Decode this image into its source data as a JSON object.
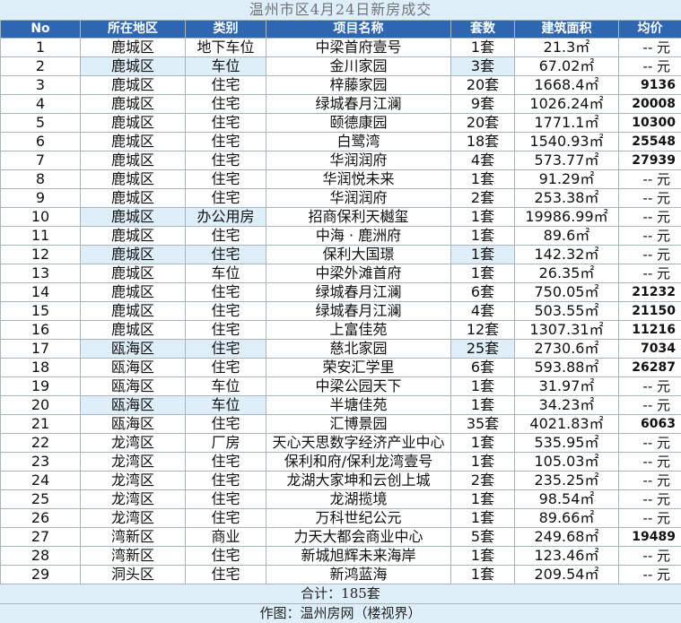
{
  "title": "温州市区4月24日新房成交",
  "columns": [
    "No",
    "所在地区",
    "类别",
    "项目名称",
    "套数",
    "建筑面积",
    "均价"
  ],
  "rows": [
    {
      "no": "1",
      "district": "鹿城区",
      "type": "地下车位",
      "project": "中梁首府壹号",
      "units": "1套",
      "area": "21.3㎡",
      "price": "-- 元"
    },
    {
      "no": "2",
      "district": "鹿城区",
      "type": "车位",
      "project": "金川家园",
      "units": "3套",
      "area": "67.02㎡",
      "price": "-- 元"
    },
    {
      "no": "3",
      "district": "鹿城区",
      "type": "住宅",
      "project": "梓藤家园",
      "units": "20套",
      "area": "1668.4㎡",
      "price": "9136"
    },
    {
      "no": "4",
      "district": "鹿城区",
      "type": "住宅",
      "project": "绿城春月江澜",
      "units": "9套",
      "area": "1026.24㎡",
      "price": "20008"
    },
    {
      "no": "5",
      "district": "鹿城区",
      "type": "住宅",
      "project": "颐德康园",
      "units": "20套",
      "area": "1771.1㎡",
      "price": "10300"
    },
    {
      "no": "6",
      "district": "鹿城区",
      "type": "住宅",
      "project": "白鹭湾",
      "units": "18套",
      "area": "1540.93㎡",
      "price": "25548"
    },
    {
      "no": "7",
      "district": "鹿城区",
      "type": "住宅",
      "project": "华润润府",
      "units": "4套",
      "area": "573.77㎡",
      "price": "27939"
    },
    {
      "no": "8",
      "district": "鹿城区",
      "type": "住宅",
      "project": "华润悦未来",
      "units": "1套",
      "area": "91.29㎡",
      "price": "-- 元"
    },
    {
      "no": "9",
      "district": "鹿城区",
      "type": "住宅",
      "project": "华润润府",
      "units": "2套",
      "area": "253.38㎡",
      "price": "-- 元"
    },
    {
      "no": "10",
      "district": "鹿城区",
      "type": "办公用房",
      "project": "招商保利天樾玺",
      "units": "1套",
      "area": "19986.99㎡",
      "price": "-- 元"
    },
    {
      "no": "11",
      "district": "鹿城区",
      "type": "住宅",
      "project": "中海 · 鹿洲府",
      "units": "1套",
      "area": "89.6㎡",
      "price": "-- 元"
    },
    {
      "no": "12",
      "district": "鹿城区",
      "type": "住宅",
      "project": "保利大国璟",
      "units": "1套",
      "area": "142.32㎡",
      "price": "-- 元"
    },
    {
      "no": "13",
      "district": "鹿城区",
      "type": "车位",
      "project": "中梁外滩首府",
      "units": "1套",
      "area": "26.35㎡",
      "price": "-- 元"
    },
    {
      "no": "14",
      "district": "鹿城区",
      "type": "住宅",
      "project": "绿城春月江澜",
      "units": "6套",
      "area": "750.05㎡",
      "price": "21232"
    },
    {
      "no": "15",
      "district": "鹿城区",
      "type": "住宅",
      "project": "绿城春月江澜",
      "units": "4套",
      "area": "503.55㎡",
      "price": "21150"
    },
    {
      "no": "16",
      "district": "鹿城区",
      "type": "住宅",
      "project": "上富佳苑",
      "units": "12套",
      "area": "1307.31㎡",
      "price": "11216"
    },
    {
      "no": "17",
      "district": "瓯海区",
      "type": "住宅",
      "project": "慈北家园",
      "units": "25套",
      "area": "2730.6㎡",
      "price": "7034"
    },
    {
      "no": "18",
      "district": "瓯海区",
      "type": "住宅",
      "project": "荣安汇学里",
      "units": "6套",
      "area": "593.88㎡",
      "price": "26287"
    },
    {
      "no": "19",
      "district": "瓯海区",
      "type": "车位",
      "project": "中梁公园天下",
      "units": "1套",
      "area": "31.97㎡",
      "price": "-- 元"
    },
    {
      "no": "20",
      "district": "瓯海区",
      "type": "车位",
      "project": "半塘佳苑",
      "units": "1套",
      "area": "34.23㎡",
      "price": "-- 元"
    },
    {
      "no": "21",
      "district": "瓯海区",
      "type": "住宅",
      "project": "汇博景园",
      "units": "35套",
      "area": "4021.83㎡",
      "price": "6063"
    },
    {
      "no": "22",
      "district": "龙湾区",
      "type": "厂房",
      "project": "天心天思数字经济产业中心",
      "units": "1套",
      "area": "535.95㎡",
      "price": "-- 元"
    },
    {
      "no": "23",
      "district": "龙湾区",
      "type": "住宅",
      "project": "保利和府/保利龙湾壹号",
      "units": "1套",
      "area": "105.03㎡",
      "price": "-- 元"
    },
    {
      "no": "24",
      "district": "龙湾区",
      "type": "住宅",
      "project": "龙湖大家坤和云创上城",
      "units": "2套",
      "area": "235.25㎡",
      "price": "-- 元"
    },
    {
      "no": "25",
      "district": "龙湾区",
      "type": "住宅",
      "project": "龙湖揽境",
      "units": "1套",
      "area": "98.54㎡",
      "price": "-- 元"
    },
    {
      "no": "26",
      "district": "龙湾区",
      "type": "住宅",
      "project": "万科世纪公元",
      "units": "1套",
      "area": "89.66㎡",
      "price": "-- 元"
    },
    {
      "no": "27",
      "district": "湾新区",
      "type": "商业",
      "project": "力天大都会商业中心",
      "units": "5套",
      "area": "249.68㎡",
      "price": "19489"
    },
    {
      "no": "28",
      "district": "湾新区",
      "type": "住宅",
      "project": "新城旭辉未来海岸",
      "units": "1套",
      "area": "123.46㎡",
      "price": "-- 元"
    },
    {
      "no": "29",
      "district": "洞头区",
      "type": "住宅",
      "project": "新鸿蓝海",
      "units": "1套",
      "area": "209.54㎡",
      "price": "-- 元"
    }
  ],
  "highlight_colors": {
    "header_bg": "#2f66b0",
    "tint": "#dfeff9",
    "grid_line": "#aab4bd"
  },
  "total": "合计：185套",
  "credit": "作图：温州房网（楼视界）"
}
